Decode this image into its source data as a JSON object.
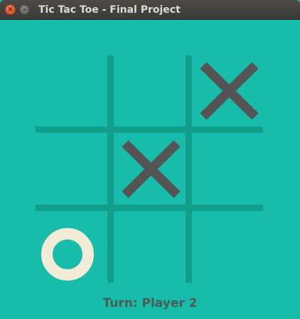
{
  "window": {
    "title": "Tic Tac Toe - Final Project",
    "close_glyph": "×",
    "minimize_glyph": "–"
  },
  "colors": {
    "background": "#17bcaa",
    "grid": "#129e8c",
    "x_mark": "#545454",
    "o_mark": "#f2ecd6",
    "status_text": "#4c5b56"
  },
  "board": {
    "cells": [
      [
        "",
        "",
        "X"
      ],
      [
        "",
        "X",
        ""
      ],
      [
        "O",
        "",
        ""
      ]
    ]
  },
  "status": {
    "turn_text": "Turn: Player 2"
  }
}
